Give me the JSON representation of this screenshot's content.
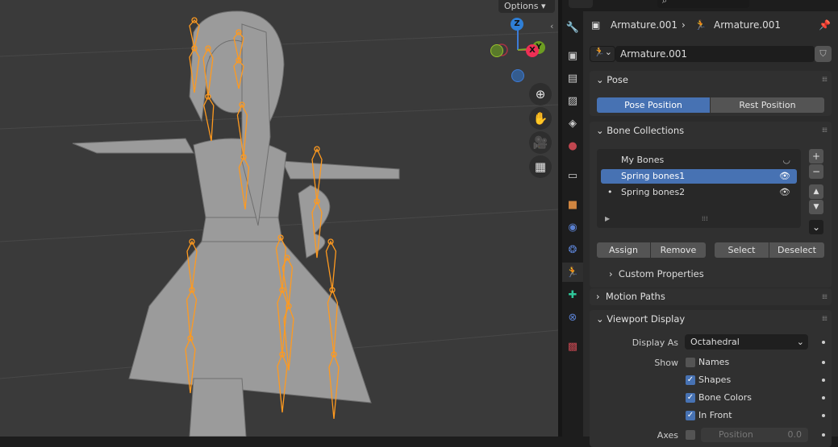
{
  "viewport": {
    "options_label": "Options",
    "gizmo": {
      "z": "Z",
      "x": "X",
      "y": "Y"
    },
    "colors": {
      "bone": "#ff9a1f",
      "mesh": "#9a9a9a"
    }
  },
  "properties": {
    "breadcrumb": {
      "object": "Armature.001",
      "data": "Armature.001"
    },
    "datablock_name": "Armature.001",
    "pose_panel": {
      "title": "Pose",
      "pose_position": "Pose Position",
      "rest_position": "Rest Position"
    },
    "bone_collections": {
      "title": "Bone Collections",
      "items": [
        {
          "name": "My Bones"
        },
        {
          "name": "Spring bones1"
        },
        {
          "name": "Spring bones2"
        }
      ],
      "assign": "Assign",
      "remove": "Remove",
      "select": "Select",
      "deselect": "Deselect",
      "custom_properties": "Custom Properties"
    },
    "motion_paths": {
      "title": "Motion Paths"
    },
    "viewport_display": {
      "title": "Viewport Display",
      "display_as_label": "Display As",
      "display_as_value": "Octahedral",
      "show_label": "Show",
      "options": [
        {
          "label": "Names",
          "checked": false
        },
        {
          "label": "Shapes",
          "checked": true
        },
        {
          "label": "Bone Colors",
          "checked": true
        },
        {
          "label": "In Front",
          "checked": true
        }
      ],
      "axes_label": "Axes",
      "position_label": "Position",
      "position_value": "0.0"
    },
    "accent": "#4772b3"
  }
}
